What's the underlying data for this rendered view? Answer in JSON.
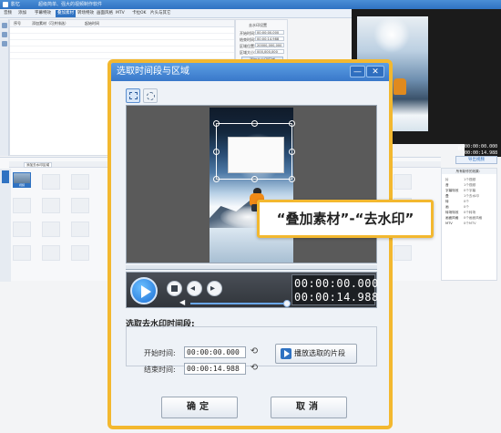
{
  "app": {
    "title": "影忆",
    "subtitle": "超级简单、强大的视频制作软件",
    "menu_tabs": [
      "音频",
      "添加",
      "字幕特效",
      "叠加素材",
      "转场特效",
      "画面风格",
      "MTV",
      "卡拉OK",
      "片头与其它"
    ],
    "active_tab": "叠加素材",
    "list_headers": [
      "序号",
      "添加素材（可并排选）",
      "起始时间"
    ],
    "props": {
      "title": "去水印设置",
      "start_label": "开始时间:",
      "start_value": "00:00:00.000",
      "end_label": "结束时间:",
      "end_value": "00:00:14.988",
      "pos_label": "区域位置:",
      "pos_value": "20000,000,000",
      "size_label": "区域大小:",
      "size_value": "000,000,000",
      "button_label": "添加去水印区域"
    },
    "preview_times": [
      "00:00:00.000",
      "00:00:14.988"
    ],
    "export_label": "导出视频",
    "right_panel": {
      "title": "所有制作的效果：",
      "rows": [
        {
          "k": "片",
          "v": "1个视频"
        },
        {
          "k": "音",
          "v": "1个视频"
        },
        {
          "k": "字幕特效",
          "v": "0个字幕"
        },
        {
          "k": "叠",
          "v": "1个去水印"
        },
        {
          "k": "转",
          "v": "0个"
        },
        {
          "k": "画",
          "v": "0个"
        },
        {
          "k": "转场特效",
          "v": "0个转场"
        },
        {
          "k": "画面风格",
          "v": "0个画面风格"
        },
        {
          "k": "MTV",
          "v": "0个MTV"
        }
      ]
    },
    "timeline": {
      "tab_label": "添加去水印区域",
      "first_clip_label": "视频"
    }
  },
  "dialog": {
    "title": "选取时间段与区域",
    "min_glyph": "—",
    "close_glyph": "✕",
    "tools": {
      "rect_icon": "rect-select-icon",
      "ellipse_icon": "ellipse-select-icon"
    },
    "callout": "“叠加素材”-“去水印”",
    "player": {
      "current_time": "00:00:00.000",
      "total_time": "00:00:14.988",
      "volume_level": 0.95,
      "scrub_position": 0.0
    },
    "section_title": "选取去水印时间段:",
    "start_label": "开始时间:",
    "start_value": "00:00:00.000",
    "end_label": "结束时间:",
    "end_value": "00:00:14.988",
    "play_selection_label": "播放选取的片段",
    "ok_label": "确定",
    "cancel_label": "取消"
  },
  "colors": {
    "accent": "#2f72c2",
    "highlight_border": "#f3b82f",
    "title_blue": "#3978c9"
  }
}
